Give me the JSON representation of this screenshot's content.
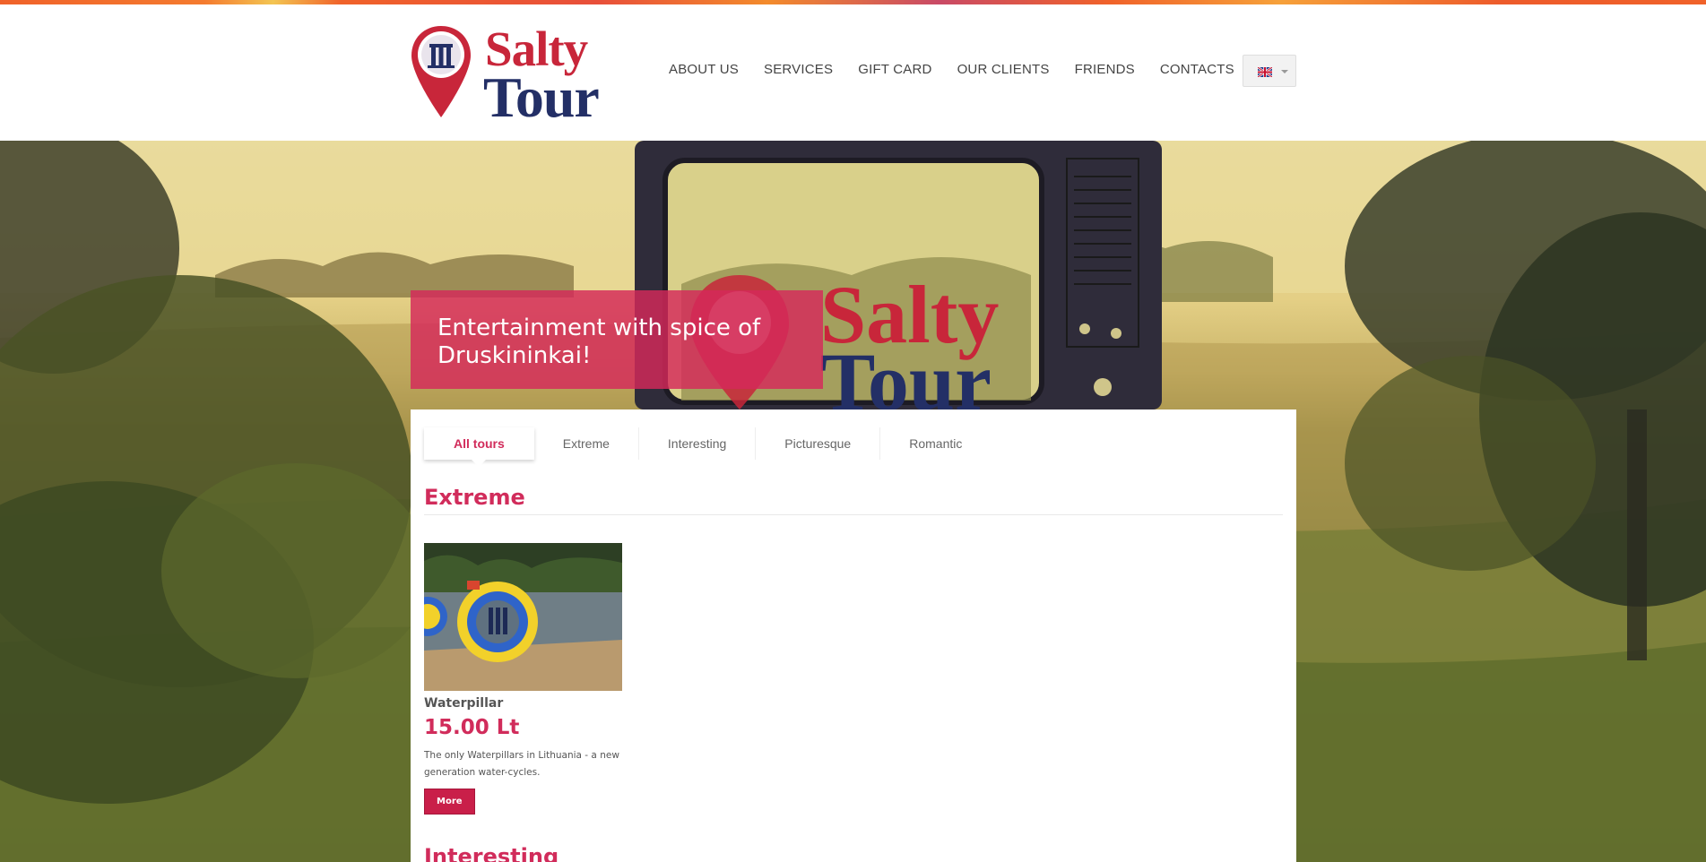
{
  "brand": {
    "name_line1": "Salty",
    "name_line2": "Tour",
    "colors": {
      "red": "#c8263a",
      "navy": "#232f66",
      "accent": "#d12c5b"
    }
  },
  "nav": {
    "items": [
      {
        "label": "ABOUT US"
      },
      {
        "label": "SERVICES"
      },
      {
        "label": "GIFT CARD"
      },
      {
        "label": "OUR CLIENTS"
      },
      {
        "label": "FRIENDS"
      },
      {
        "label": "CONTACTS"
      }
    ],
    "language": {
      "icon": "uk-flag-icon",
      "caret_icon": "chevron-down-icon"
    }
  },
  "hero": {
    "tagline": "Entertainment with spice of Druskininkai!",
    "thumbnails": [
      {
        "icon": "tv-scene-thumbnail",
        "active": true
      },
      {
        "icon": "can-thumbnail",
        "active": false
      },
      {
        "icon": "night-thumbnail",
        "active": false
      }
    ]
  },
  "tabs": [
    {
      "label": "All tours",
      "active": true
    },
    {
      "label": "Extreme",
      "active": false
    },
    {
      "label": "Interesting",
      "active": false
    },
    {
      "label": "Picturesque",
      "active": false
    },
    {
      "label": "Romantic",
      "active": false
    }
  ],
  "sections": [
    {
      "title": "Extreme",
      "items": [
        {
          "name": "Waterpillar",
          "price": "15.00 Lt",
          "description": "The only Waterpillars in Lithuania - a new generation water-cycles.",
          "button": "More"
        }
      ]
    },
    {
      "title": "Interesting"
    }
  ]
}
